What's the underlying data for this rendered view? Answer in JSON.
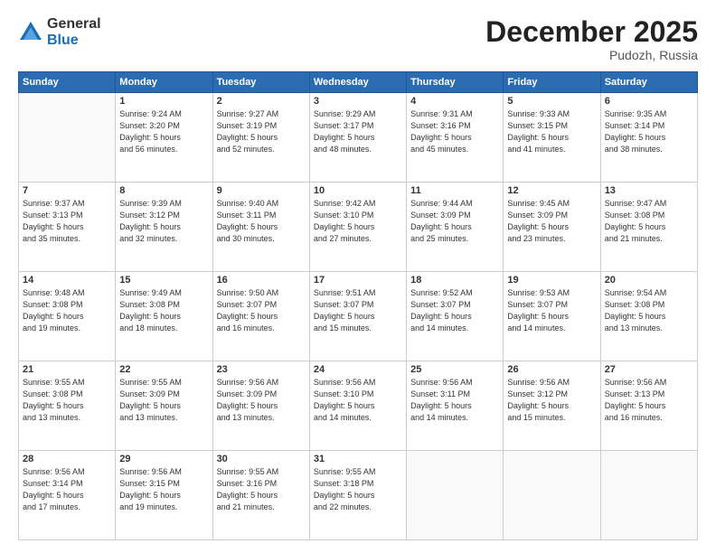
{
  "logo": {
    "general": "General",
    "blue": "Blue"
  },
  "title": "December 2025",
  "location": "Pudozh, Russia",
  "days_header": [
    "Sunday",
    "Monday",
    "Tuesday",
    "Wednesday",
    "Thursday",
    "Friday",
    "Saturday"
  ],
  "weeks": [
    [
      {
        "day": "",
        "info": ""
      },
      {
        "day": "1",
        "info": "Sunrise: 9:24 AM\nSunset: 3:20 PM\nDaylight: 5 hours\nand 56 minutes."
      },
      {
        "day": "2",
        "info": "Sunrise: 9:27 AM\nSunset: 3:19 PM\nDaylight: 5 hours\nand 52 minutes."
      },
      {
        "day": "3",
        "info": "Sunrise: 9:29 AM\nSunset: 3:17 PM\nDaylight: 5 hours\nand 48 minutes."
      },
      {
        "day": "4",
        "info": "Sunrise: 9:31 AM\nSunset: 3:16 PM\nDaylight: 5 hours\nand 45 minutes."
      },
      {
        "day": "5",
        "info": "Sunrise: 9:33 AM\nSunset: 3:15 PM\nDaylight: 5 hours\nand 41 minutes."
      },
      {
        "day": "6",
        "info": "Sunrise: 9:35 AM\nSunset: 3:14 PM\nDaylight: 5 hours\nand 38 minutes."
      }
    ],
    [
      {
        "day": "7",
        "info": "Sunrise: 9:37 AM\nSunset: 3:13 PM\nDaylight: 5 hours\nand 35 minutes."
      },
      {
        "day": "8",
        "info": "Sunrise: 9:39 AM\nSunset: 3:12 PM\nDaylight: 5 hours\nand 32 minutes."
      },
      {
        "day": "9",
        "info": "Sunrise: 9:40 AM\nSunset: 3:11 PM\nDaylight: 5 hours\nand 30 minutes."
      },
      {
        "day": "10",
        "info": "Sunrise: 9:42 AM\nSunset: 3:10 PM\nDaylight: 5 hours\nand 27 minutes."
      },
      {
        "day": "11",
        "info": "Sunrise: 9:44 AM\nSunset: 3:09 PM\nDaylight: 5 hours\nand 25 minutes."
      },
      {
        "day": "12",
        "info": "Sunrise: 9:45 AM\nSunset: 3:09 PM\nDaylight: 5 hours\nand 23 minutes."
      },
      {
        "day": "13",
        "info": "Sunrise: 9:47 AM\nSunset: 3:08 PM\nDaylight: 5 hours\nand 21 minutes."
      }
    ],
    [
      {
        "day": "14",
        "info": "Sunrise: 9:48 AM\nSunset: 3:08 PM\nDaylight: 5 hours\nand 19 minutes."
      },
      {
        "day": "15",
        "info": "Sunrise: 9:49 AM\nSunset: 3:08 PM\nDaylight: 5 hours\nand 18 minutes."
      },
      {
        "day": "16",
        "info": "Sunrise: 9:50 AM\nSunset: 3:07 PM\nDaylight: 5 hours\nand 16 minutes."
      },
      {
        "day": "17",
        "info": "Sunrise: 9:51 AM\nSunset: 3:07 PM\nDaylight: 5 hours\nand 15 minutes."
      },
      {
        "day": "18",
        "info": "Sunrise: 9:52 AM\nSunset: 3:07 PM\nDaylight: 5 hours\nand 14 minutes."
      },
      {
        "day": "19",
        "info": "Sunrise: 9:53 AM\nSunset: 3:07 PM\nDaylight: 5 hours\nand 14 minutes."
      },
      {
        "day": "20",
        "info": "Sunrise: 9:54 AM\nSunset: 3:08 PM\nDaylight: 5 hours\nand 13 minutes."
      }
    ],
    [
      {
        "day": "21",
        "info": "Sunrise: 9:55 AM\nSunset: 3:08 PM\nDaylight: 5 hours\nand 13 minutes."
      },
      {
        "day": "22",
        "info": "Sunrise: 9:55 AM\nSunset: 3:09 PM\nDaylight: 5 hours\nand 13 minutes."
      },
      {
        "day": "23",
        "info": "Sunrise: 9:56 AM\nSunset: 3:09 PM\nDaylight: 5 hours\nand 13 minutes."
      },
      {
        "day": "24",
        "info": "Sunrise: 9:56 AM\nSunset: 3:10 PM\nDaylight: 5 hours\nand 14 minutes."
      },
      {
        "day": "25",
        "info": "Sunrise: 9:56 AM\nSunset: 3:11 PM\nDaylight: 5 hours\nand 14 minutes."
      },
      {
        "day": "26",
        "info": "Sunrise: 9:56 AM\nSunset: 3:12 PM\nDaylight: 5 hours\nand 15 minutes."
      },
      {
        "day": "27",
        "info": "Sunrise: 9:56 AM\nSunset: 3:13 PM\nDaylight: 5 hours\nand 16 minutes."
      }
    ],
    [
      {
        "day": "28",
        "info": "Sunrise: 9:56 AM\nSunset: 3:14 PM\nDaylight: 5 hours\nand 17 minutes."
      },
      {
        "day": "29",
        "info": "Sunrise: 9:56 AM\nSunset: 3:15 PM\nDaylight: 5 hours\nand 19 minutes."
      },
      {
        "day": "30",
        "info": "Sunrise: 9:55 AM\nSunset: 3:16 PM\nDaylight: 5 hours\nand 21 minutes."
      },
      {
        "day": "31",
        "info": "Sunrise: 9:55 AM\nSunset: 3:18 PM\nDaylight: 5 hours\nand 22 minutes."
      },
      {
        "day": "",
        "info": ""
      },
      {
        "day": "",
        "info": ""
      },
      {
        "day": "",
        "info": ""
      }
    ]
  ]
}
